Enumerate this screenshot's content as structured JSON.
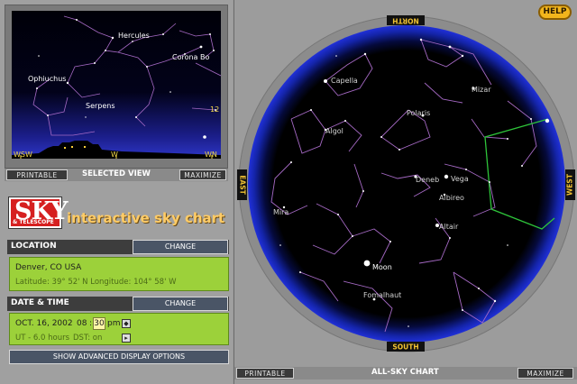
{
  "preview": {
    "labels": [
      "Hercules",
      "Corona Bo",
      "Ophiuchus",
      "Serpens",
      "12"
    ],
    "horizon": [
      "WSW",
      "W",
      "WN"
    ],
    "printable_label": "PRINTABLE",
    "title": "SELECTED VIEW",
    "maximize_label": "MAXIMIZE"
  },
  "brand": {
    "logo_text": "SKY",
    "logo_sub": "& TELESCOPE",
    "title": "interactive sky chart"
  },
  "location": {
    "heading": "LOCATION",
    "change_label": "CHANGE",
    "city": "Denver, CO USA",
    "coords": "Latitude: 39° 52' N    Longitude: 104° 58' W"
  },
  "datetime": {
    "heading": "DATE & TIME",
    "change_label": "CHANGE",
    "date": "OCT. 16, 2002",
    "hour": "08",
    "minute": "30",
    "ampm": "pm",
    "ut": "UT - 6.0 hours",
    "dst": "DST: on"
  },
  "advanced_label": "SHOW ADVANCED DISPLAY OPTIONS",
  "help_label": "HELP",
  "allsky": {
    "north": "NORTH",
    "south": "SOUTH",
    "east": "EAST",
    "west": "WEST",
    "labels": [
      "Capella",
      "Mizar",
      "Polaris",
      "Algol",
      "Deneb",
      "Vega",
      "Albireo",
      "Mira",
      "Altair",
      "Moon",
      "Fomalhaut"
    ],
    "printable_label": "PRINTABLE",
    "title": "ALL-SKY CHART",
    "maximize_label": "MAXIMIZE"
  },
  "colors": {
    "sky": "#000000",
    "rim": "#1a28c8",
    "constellation": "#a569c4",
    "view_box": "#2ec43a",
    "panel_green": "#9cd13a",
    "help": "#f2b51c"
  }
}
